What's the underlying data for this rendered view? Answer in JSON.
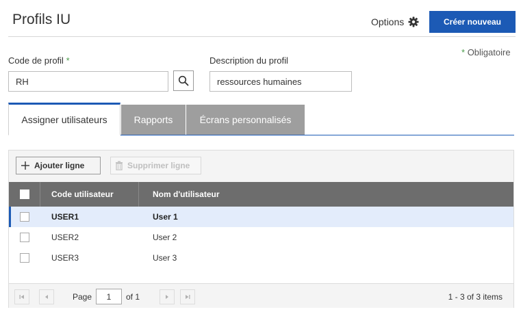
{
  "header": {
    "title": "Profils IU",
    "options_label": "Options",
    "create_label": "Créer nouveau"
  },
  "form": {
    "required_note_star": "*",
    "required_note_text": "Obligatoire",
    "code_label": "Code de profil",
    "code_required_star": "*",
    "code_value": "RH",
    "description_label": "Description du profil",
    "description_value": "ressources humaines"
  },
  "tabs": [
    {
      "label": "Assigner utilisateurs",
      "active": true
    },
    {
      "label": "Rapports",
      "active": false
    },
    {
      "label": "Écrans personnalisés",
      "active": false
    }
  ],
  "toolbar": {
    "add_label": "Ajouter ligne",
    "delete_label": "Supprimer ligne"
  },
  "table": {
    "columns": [
      "Code utilisateur",
      "Nom d'utilisateur"
    ],
    "rows": [
      {
        "code": "USER1",
        "name": "User 1",
        "selected": true
      },
      {
        "code": "USER2",
        "name": "User 2",
        "selected": false
      },
      {
        "code": "USER3",
        "name": "User 3",
        "selected": false
      }
    ]
  },
  "pager": {
    "page_label": "Page",
    "current_page": "1",
    "of_label": "of 1",
    "count_label": "1 - 3 of 3 items"
  },
  "colors": {
    "accent": "#1c5ab5",
    "required_star": "#4a9b4a",
    "table_header": "#6d6d6d",
    "selected_row": "#e3ecfb",
    "inactive_tab": "#9e9e9e"
  },
  "icons": {
    "options": "gear-icon",
    "search": "search-icon",
    "add": "plus-icon",
    "delete": "trash-icon",
    "first": "first-page-icon",
    "prev": "previous-page-icon",
    "next": "next-page-icon",
    "last": "last-page-icon"
  }
}
